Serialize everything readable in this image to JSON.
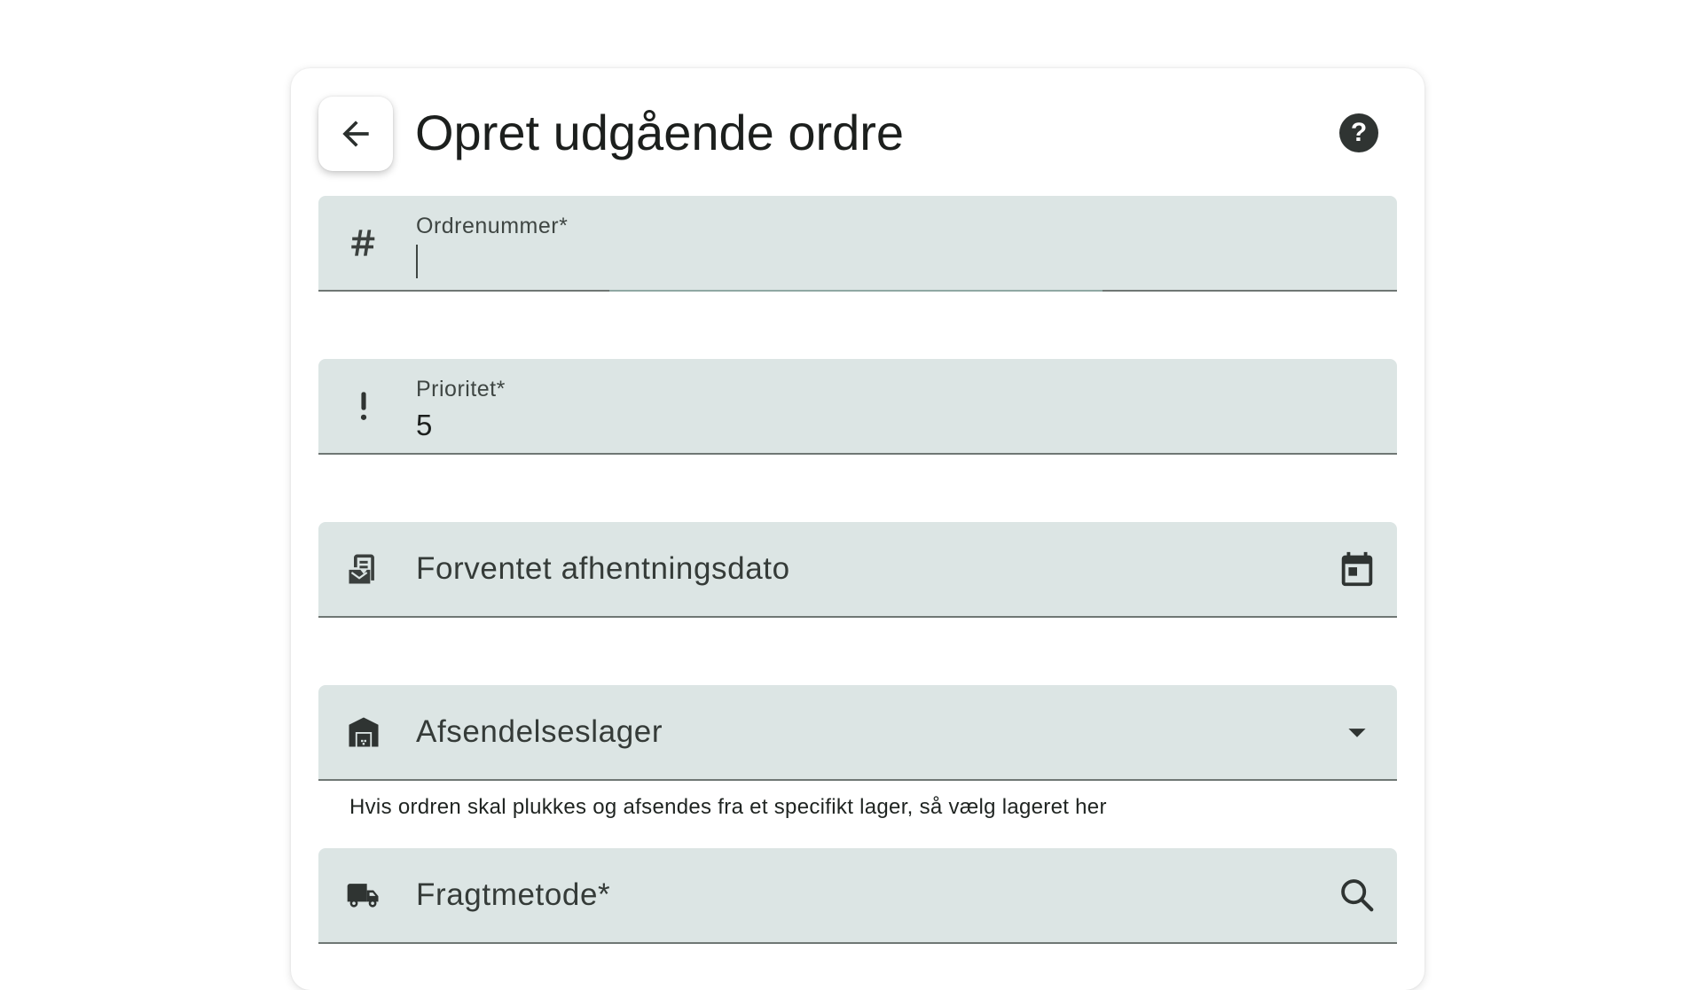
{
  "header": {
    "title": "Opret udgående ordre",
    "help_symbol": "?"
  },
  "icons": {
    "back": "arrow-left-icon",
    "help": "help-circle-icon",
    "order_number": "hash-icon",
    "priority": "exclamation-icon",
    "pickup_date": "pickup-inbox-icon",
    "calendar": "calendar-icon",
    "warehouse": "warehouse-icon",
    "dropdown": "arrow-drop-down-icon",
    "shipping": "truck-icon",
    "search": "search-icon"
  },
  "form": {
    "order_number": {
      "label": "Ordrenummer*",
      "value": ""
    },
    "priority": {
      "label": "Prioritet*",
      "value": "5"
    },
    "pickup_date": {
      "label": "Forventet afhentningsdato"
    },
    "warehouse": {
      "label": "Afsendelseslager",
      "hint": "Hvis ordren skal plukkes og afsendes fra et specifikt lager, så vælg lageret her"
    },
    "shipping_method": {
      "label": "Fragtmetode*"
    }
  },
  "colors": {
    "field_bg": "#dce5e4",
    "text": "#1c1f1d",
    "icon": "#2f3432",
    "focus_accent": "#8fa8a3"
  }
}
